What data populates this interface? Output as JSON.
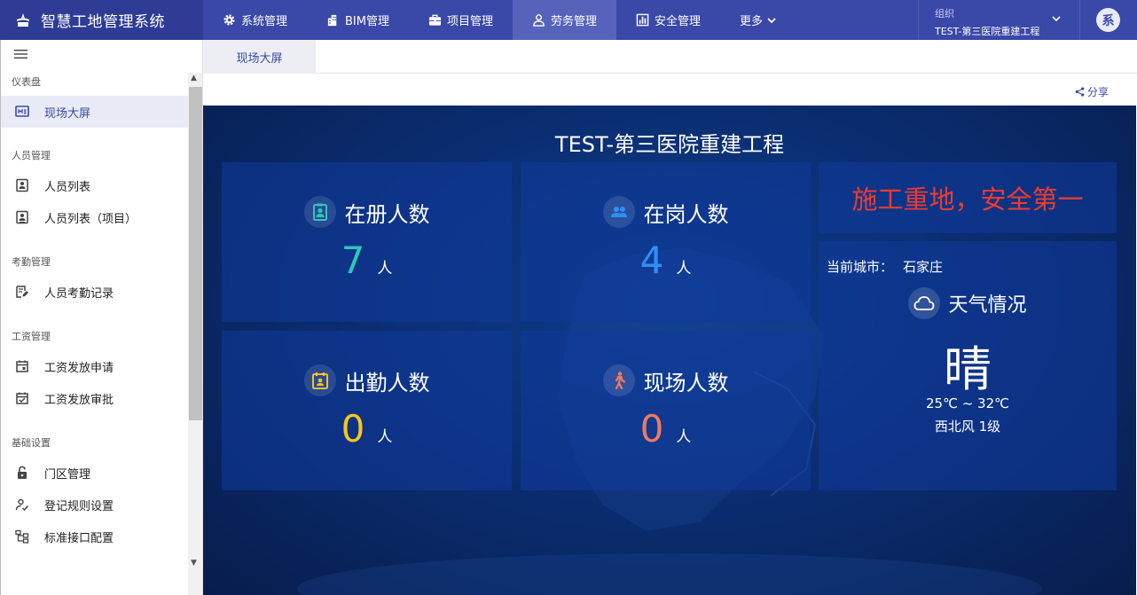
{
  "app": {
    "title": "智慧工地管理系统",
    "colors": {
      "header": "#3a48a8",
      "brand": "#2f3c96",
      "accent": "#3a48a8"
    }
  },
  "topnav": {
    "items": [
      {
        "label": "系统管理",
        "icon": "gear-icon"
      },
      {
        "label": "BIM管理",
        "icon": "building-icon"
      },
      {
        "label": "项目管理",
        "icon": "briefcase-icon"
      },
      {
        "label": "劳务管理",
        "icon": "person-icon",
        "active": true
      },
      {
        "label": "安全管理",
        "icon": "bar-chart-icon"
      },
      {
        "label": "更多",
        "icon": "chevron-down-icon"
      }
    ]
  },
  "org": {
    "label": "组织",
    "name": "TEST-第三医院重建工程"
  },
  "user": {
    "avatar_text": "系"
  },
  "sidebar": {
    "sections": [
      {
        "title": "仪表盘",
        "items": [
          {
            "label": "现场大屏",
            "icon": "monitor-icon",
            "active": true
          }
        ]
      },
      {
        "title": "人员管理",
        "items": [
          {
            "label": "人员列表",
            "icon": "id-card-icon"
          },
          {
            "label": "人员列表（项目）",
            "icon": "badge-icon"
          }
        ]
      },
      {
        "title": "考勤管理",
        "items": [
          {
            "label": "人员考勤记录",
            "icon": "edit-note-icon"
          }
        ]
      },
      {
        "title": "工资管理",
        "items": [
          {
            "label": "工资发放申请",
            "icon": "calendar-icon"
          },
          {
            "label": "工资发放审批",
            "icon": "calendar-check-icon"
          }
        ]
      },
      {
        "title": "基础设置",
        "items": [
          {
            "label": "门区管理",
            "icon": "lock-icon"
          },
          {
            "label": "登记规则设置",
            "icon": "person-check-icon"
          },
          {
            "label": "标准接口配置",
            "icon": "hierarchy-icon"
          }
        ]
      }
    ]
  },
  "tabs": [
    {
      "label": "现场大屏"
    }
  ],
  "toolbar": {
    "share_label": "分享"
  },
  "dashboard": {
    "title": "TEST-第三医院重建工程",
    "cards": [
      {
        "label": "在册人数",
        "value": "7",
        "unit": "人",
        "color": "#2ec7b6",
        "icon": "id-badge-icon"
      },
      {
        "label": "在岗人数",
        "value": "4",
        "unit": "人",
        "color": "#2f8ff5",
        "icon": "people-icon"
      },
      {
        "label": "出勤人数",
        "value": "0",
        "unit": "人",
        "color": "#f7c51c",
        "icon": "attendance-icon"
      },
      {
        "label": "现场人数",
        "value": "0",
        "unit": "人",
        "color": "#f07a5f",
        "icon": "walking-icon"
      }
    ],
    "slogan": "施工重地，安全第一",
    "slogan_color": "#ee3b30",
    "weather": {
      "city_label": "当前城市：",
      "city": "石家庄",
      "title": "天气情况",
      "condition": "晴",
      "temp": "25℃ ~ 32℃",
      "wind": "西北风 1级"
    }
  }
}
